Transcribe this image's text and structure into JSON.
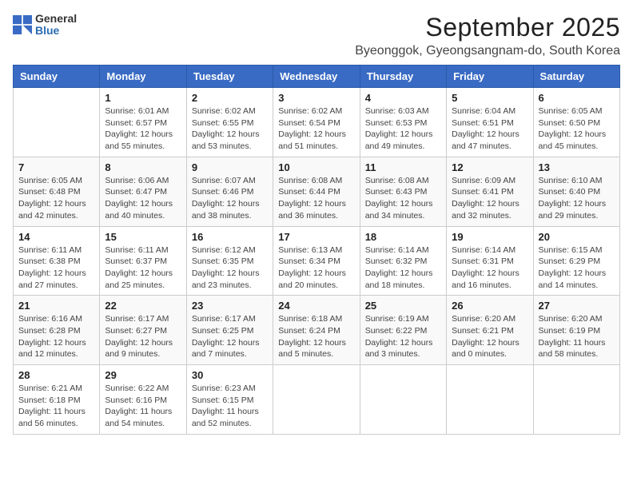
{
  "logo": {
    "general": "General",
    "blue": "Blue"
  },
  "title": "September 2025",
  "location": "Byeonggok, Gyeongsangnam-do, South Korea",
  "weekdays": [
    "Sunday",
    "Monday",
    "Tuesday",
    "Wednesday",
    "Thursday",
    "Friday",
    "Saturday"
  ],
  "weeks": [
    [
      {
        "day": "",
        "info": ""
      },
      {
        "day": "1",
        "info": "Sunrise: 6:01 AM\nSunset: 6:57 PM\nDaylight: 12 hours\nand 55 minutes."
      },
      {
        "day": "2",
        "info": "Sunrise: 6:02 AM\nSunset: 6:55 PM\nDaylight: 12 hours\nand 53 minutes."
      },
      {
        "day": "3",
        "info": "Sunrise: 6:02 AM\nSunset: 6:54 PM\nDaylight: 12 hours\nand 51 minutes."
      },
      {
        "day": "4",
        "info": "Sunrise: 6:03 AM\nSunset: 6:53 PM\nDaylight: 12 hours\nand 49 minutes."
      },
      {
        "day": "5",
        "info": "Sunrise: 6:04 AM\nSunset: 6:51 PM\nDaylight: 12 hours\nand 47 minutes."
      },
      {
        "day": "6",
        "info": "Sunrise: 6:05 AM\nSunset: 6:50 PM\nDaylight: 12 hours\nand 45 minutes."
      }
    ],
    [
      {
        "day": "7",
        "info": "Sunrise: 6:05 AM\nSunset: 6:48 PM\nDaylight: 12 hours\nand 42 minutes."
      },
      {
        "day": "8",
        "info": "Sunrise: 6:06 AM\nSunset: 6:47 PM\nDaylight: 12 hours\nand 40 minutes."
      },
      {
        "day": "9",
        "info": "Sunrise: 6:07 AM\nSunset: 6:46 PM\nDaylight: 12 hours\nand 38 minutes."
      },
      {
        "day": "10",
        "info": "Sunrise: 6:08 AM\nSunset: 6:44 PM\nDaylight: 12 hours\nand 36 minutes."
      },
      {
        "day": "11",
        "info": "Sunrise: 6:08 AM\nSunset: 6:43 PM\nDaylight: 12 hours\nand 34 minutes."
      },
      {
        "day": "12",
        "info": "Sunrise: 6:09 AM\nSunset: 6:41 PM\nDaylight: 12 hours\nand 32 minutes."
      },
      {
        "day": "13",
        "info": "Sunrise: 6:10 AM\nSunset: 6:40 PM\nDaylight: 12 hours\nand 29 minutes."
      }
    ],
    [
      {
        "day": "14",
        "info": "Sunrise: 6:11 AM\nSunset: 6:38 PM\nDaylight: 12 hours\nand 27 minutes."
      },
      {
        "day": "15",
        "info": "Sunrise: 6:11 AM\nSunset: 6:37 PM\nDaylight: 12 hours\nand 25 minutes."
      },
      {
        "day": "16",
        "info": "Sunrise: 6:12 AM\nSunset: 6:35 PM\nDaylight: 12 hours\nand 23 minutes."
      },
      {
        "day": "17",
        "info": "Sunrise: 6:13 AM\nSunset: 6:34 PM\nDaylight: 12 hours\nand 20 minutes."
      },
      {
        "day": "18",
        "info": "Sunrise: 6:14 AM\nSunset: 6:32 PM\nDaylight: 12 hours\nand 18 minutes."
      },
      {
        "day": "19",
        "info": "Sunrise: 6:14 AM\nSunset: 6:31 PM\nDaylight: 12 hours\nand 16 minutes."
      },
      {
        "day": "20",
        "info": "Sunrise: 6:15 AM\nSunset: 6:29 PM\nDaylight: 12 hours\nand 14 minutes."
      }
    ],
    [
      {
        "day": "21",
        "info": "Sunrise: 6:16 AM\nSunset: 6:28 PM\nDaylight: 12 hours\nand 12 minutes."
      },
      {
        "day": "22",
        "info": "Sunrise: 6:17 AM\nSunset: 6:27 PM\nDaylight: 12 hours\nand 9 minutes."
      },
      {
        "day": "23",
        "info": "Sunrise: 6:17 AM\nSunset: 6:25 PM\nDaylight: 12 hours\nand 7 minutes."
      },
      {
        "day": "24",
        "info": "Sunrise: 6:18 AM\nSunset: 6:24 PM\nDaylight: 12 hours\nand 5 minutes."
      },
      {
        "day": "25",
        "info": "Sunrise: 6:19 AM\nSunset: 6:22 PM\nDaylight: 12 hours\nand 3 minutes."
      },
      {
        "day": "26",
        "info": "Sunrise: 6:20 AM\nSunset: 6:21 PM\nDaylight: 12 hours\nand 0 minutes."
      },
      {
        "day": "27",
        "info": "Sunrise: 6:20 AM\nSunset: 6:19 PM\nDaylight: 11 hours\nand 58 minutes."
      }
    ],
    [
      {
        "day": "28",
        "info": "Sunrise: 6:21 AM\nSunset: 6:18 PM\nDaylight: 11 hours\nand 56 minutes."
      },
      {
        "day": "29",
        "info": "Sunrise: 6:22 AM\nSunset: 6:16 PM\nDaylight: 11 hours\nand 54 minutes."
      },
      {
        "day": "30",
        "info": "Sunrise: 6:23 AM\nSunset: 6:15 PM\nDaylight: 11 hours\nand 52 minutes."
      },
      {
        "day": "",
        "info": ""
      },
      {
        "day": "",
        "info": ""
      },
      {
        "day": "",
        "info": ""
      },
      {
        "day": "",
        "info": ""
      }
    ]
  ]
}
